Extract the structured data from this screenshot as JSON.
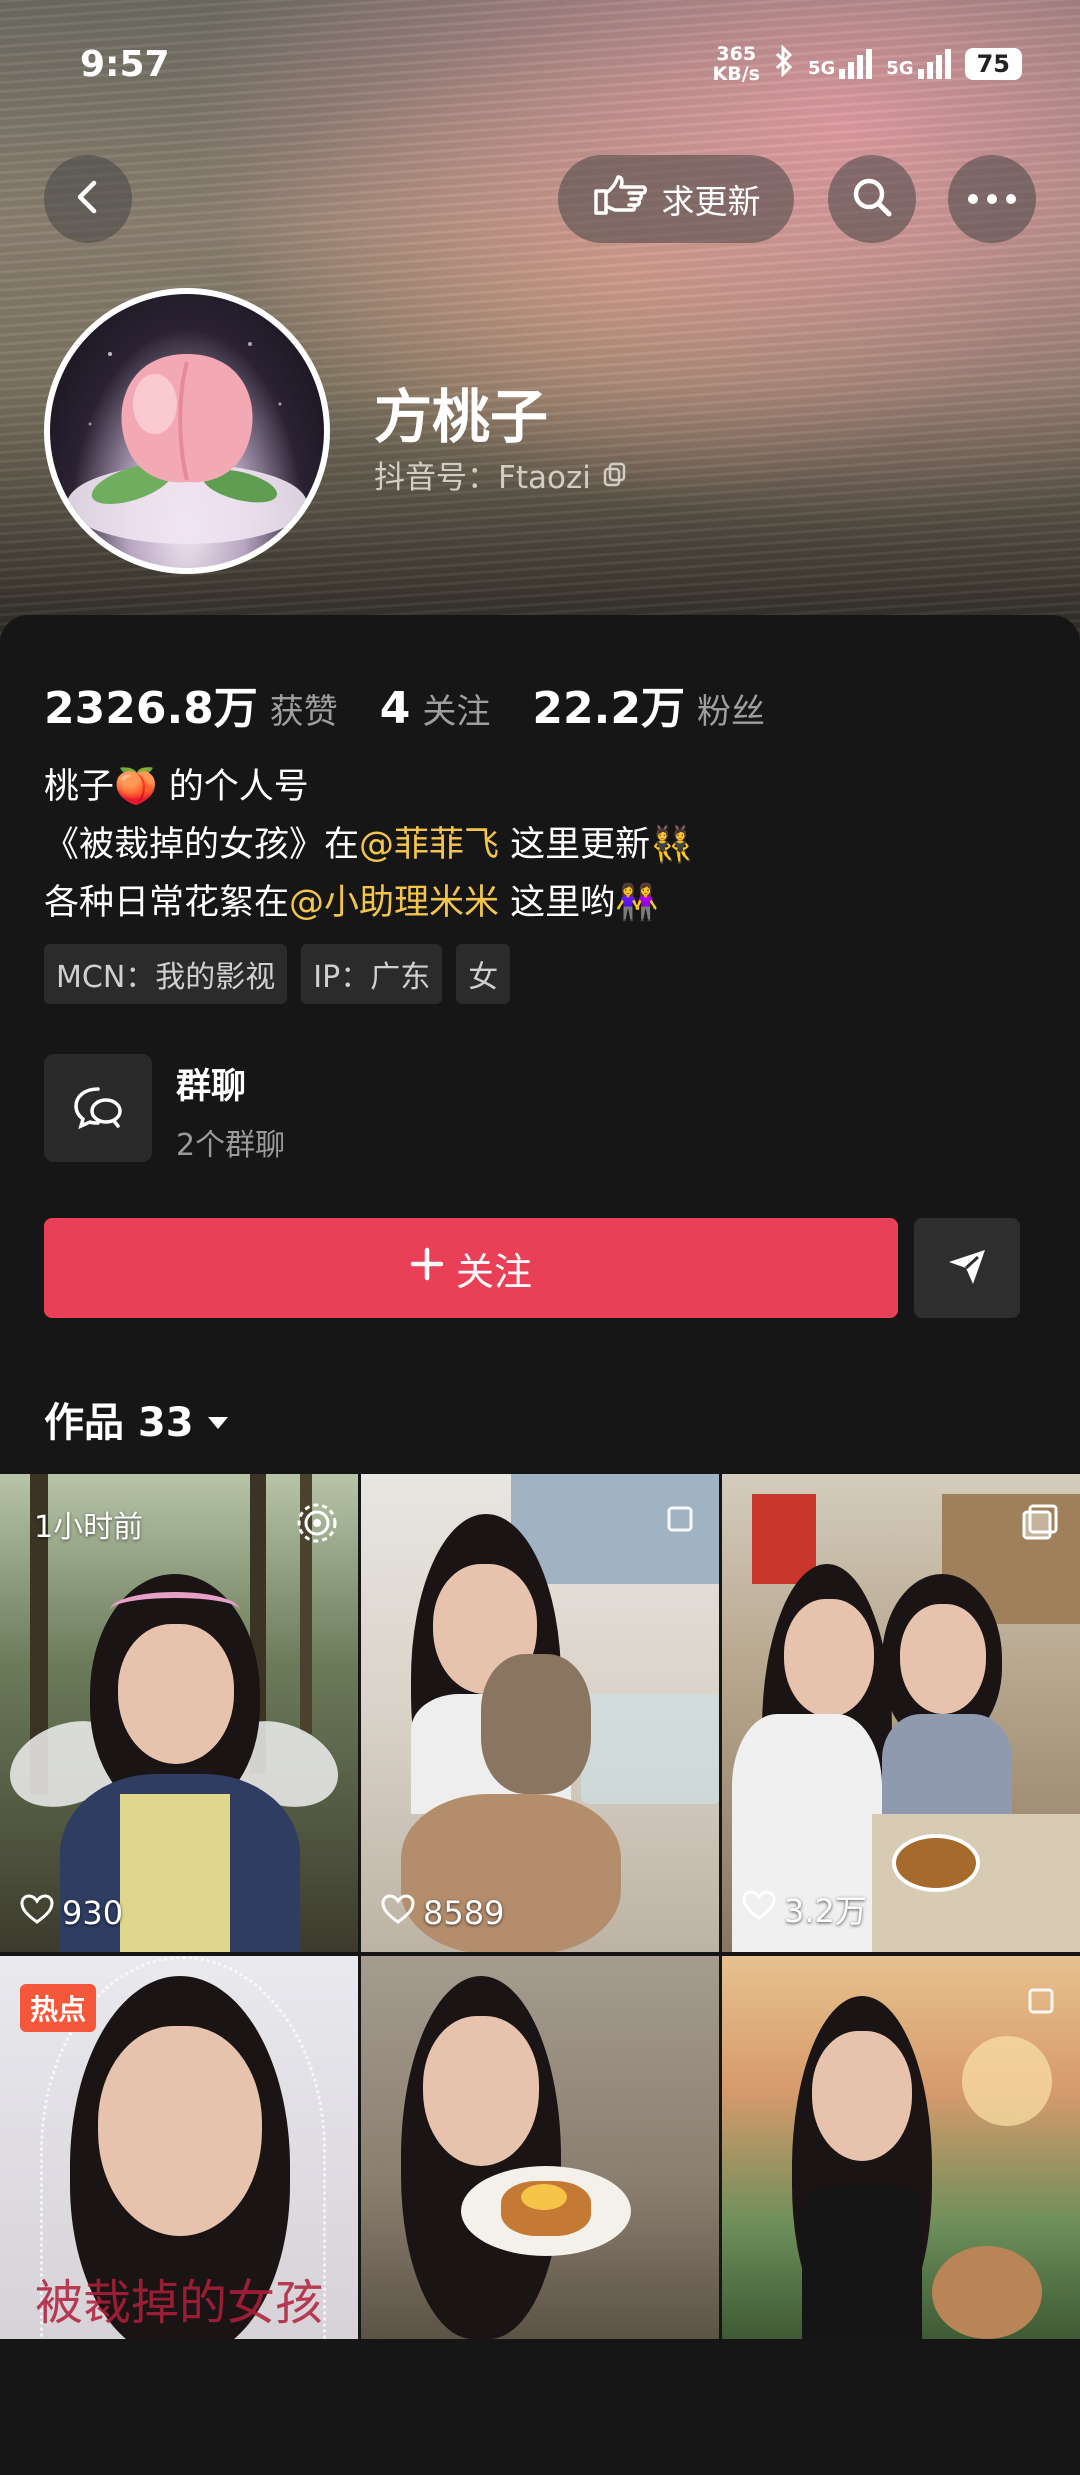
{
  "status_bar": {
    "time": "9:57",
    "net_speed_value": "365",
    "net_speed_unit": "KB/s",
    "sim1": "5G",
    "sim2": "5G",
    "battery": "75"
  },
  "header": {
    "request_update_label": "求更新"
  },
  "profile": {
    "name": "方桃子",
    "douyin_id": "抖音号：Ftaozi"
  },
  "stats": [
    {
      "value": "2326.8万",
      "label": "获赞"
    },
    {
      "value": "4",
      "label": "关注"
    },
    {
      "value": "22.2万",
      "label": "粉丝"
    }
  ],
  "bio": {
    "line1": "桃子🍑 的个人号",
    "line2_pre": "《被裁掉的女孩》在",
    "line2_mention": "@菲菲飞",
    "line2_post": " 这里更新👯",
    "line3_pre": "各种日常花絮在",
    "line3_mention": "@小助理米米",
    "line3_post": " 这里哟👭"
  },
  "tags": [
    "MCN：我的影视",
    "IP：广东",
    "女"
  ],
  "group_chat": {
    "title": "群聊",
    "subtitle": "2个群聊"
  },
  "actions": {
    "follow_label": "关注"
  },
  "works": {
    "label": "作品 33"
  },
  "videos": [
    {
      "likes": "930",
      "time": "1小时前"
    },
    {
      "likes": "8589"
    },
    {
      "likes": "3.2万"
    },
    {
      "hot": "热点",
      "caption": "被裁掉的女孩"
    },
    {},
    {}
  ]
}
